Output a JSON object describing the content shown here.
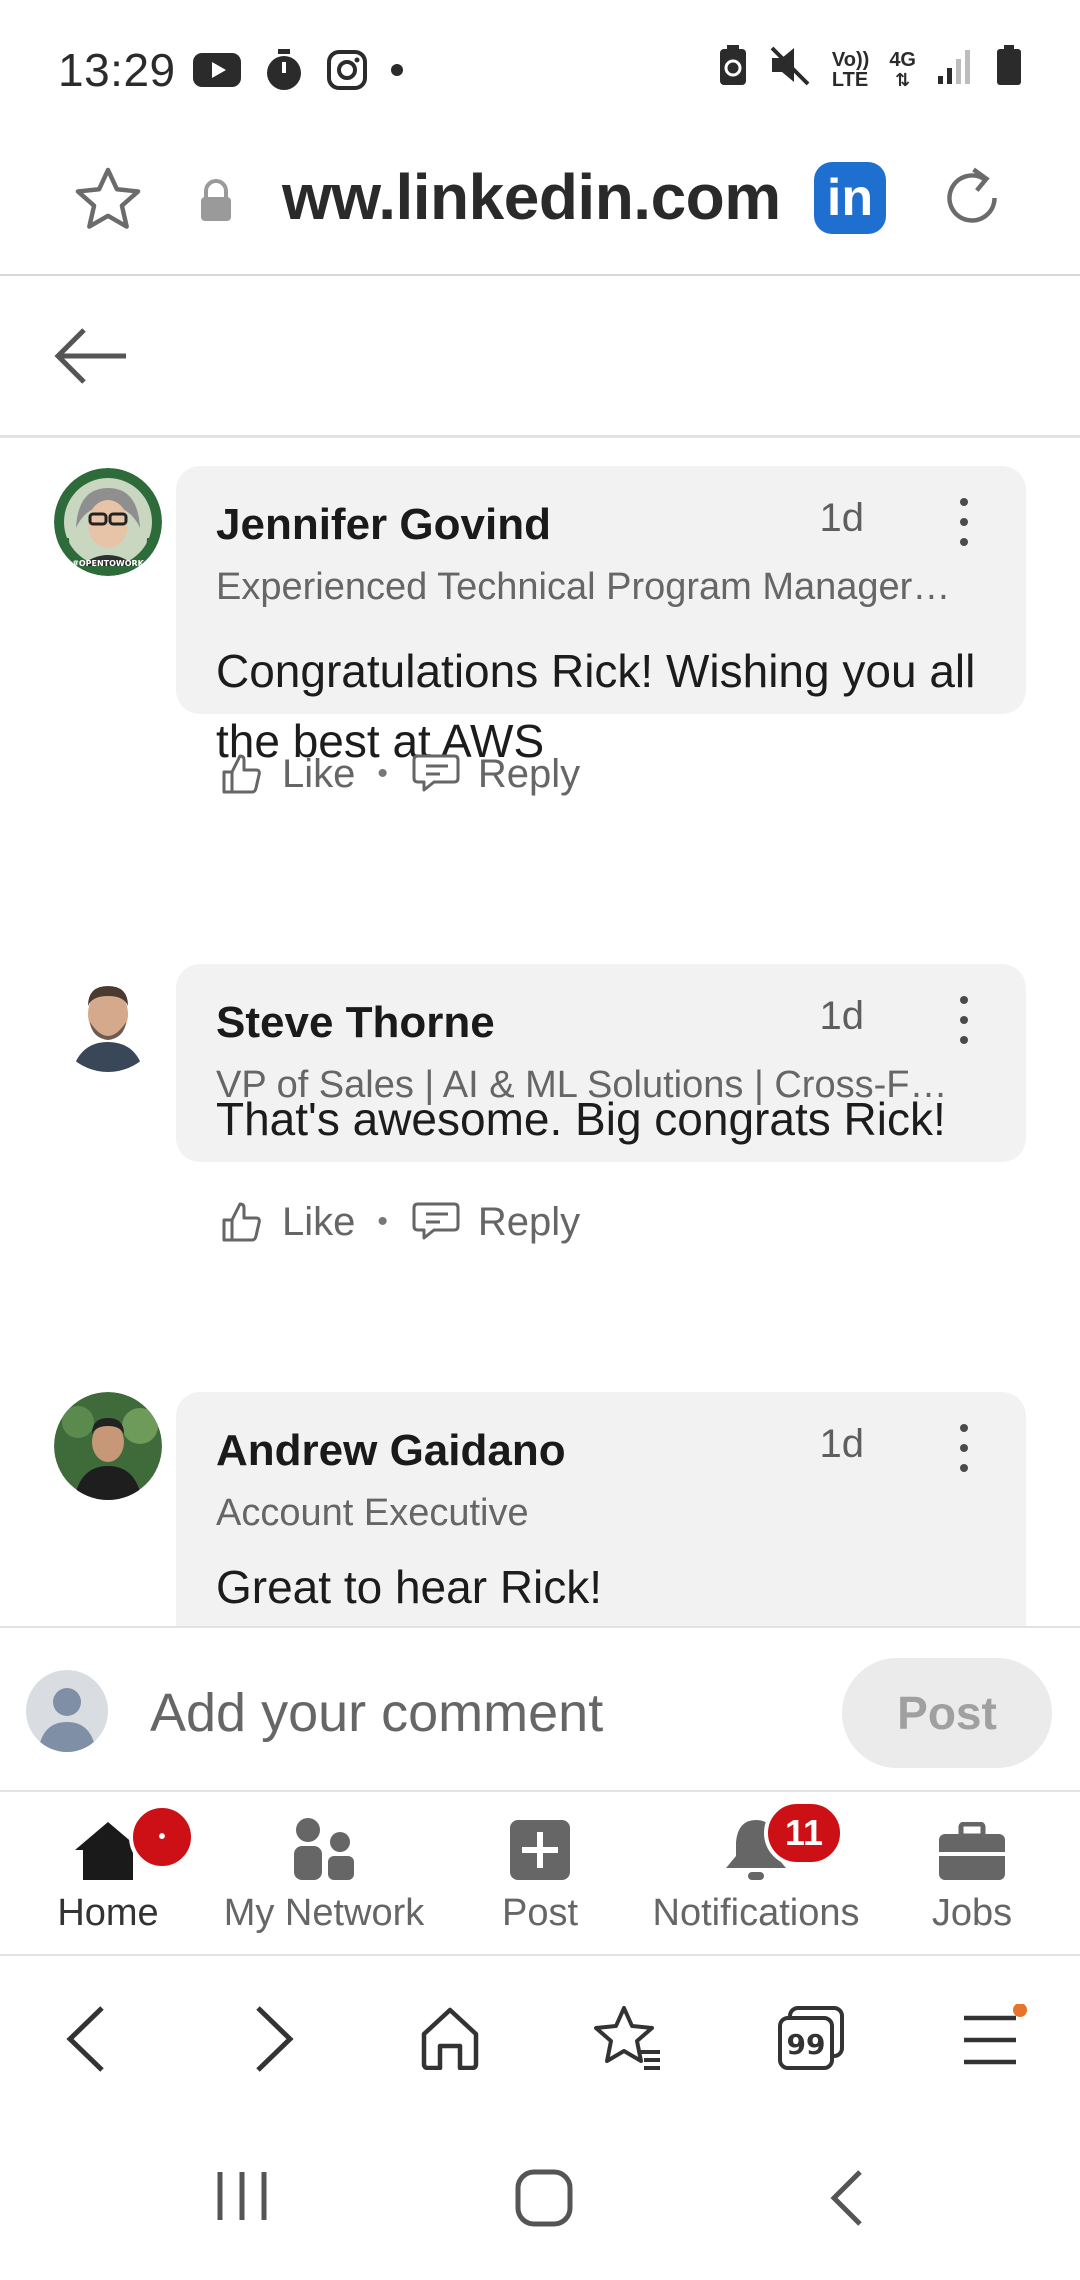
{
  "status_bar": {
    "time": "13:29",
    "network_label": "4G",
    "volte_label_top": "Vo))",
    "volte_label_bottom": "LTE"
  },
  "browser": {
    "url": "ww.linkedin.com",
    "site_badge": "in"
  },
  "comments": [
    {
      "name": "Jennifer Govind",
      "time": "1d",
      "headline": "Experienced Technical Program Manager…",
      "text": "Congratulations Rick!  Wishing you all the best at AWS",
      "avatar_badge": "#OPENTOWORK",
      "like_label": "Like",
      "reply_label": "Reply"
    },
    {
      "name": "Steve Thorne",
      "time": "1d",
      "headline": "VP of Sales | AI & ML Solutions | Cross-F…",
      "text": "That's awesome. Big congrats Rick!",
      "like_label": "Like",
      "reply_label": "Reply"
    },
    {
      "name": "Andrew Gaidano",
      "time": "1d",
      "headline": "Account Executive",
      "text": "Great to hear Rick!"
    }
  ],
  "comment_input": {
    "placeholder": "Add your comment",
    "post_label": "Post"
  },
  "li_nav": {
    "home": "Home",
    "network": "My Network",
    "post": "Post",
    "notifications": "Notifications",
    "notifications_count": "11",
    "jobs": "Jobs"
  },
  "colors": {
    "linkedin_blue": "#1f6fd0",
    "badge_red": "#cc1016",
    "bubble_bg": "#f2f2f2",
    "menu_dot": "#e8742b"
  }
}
